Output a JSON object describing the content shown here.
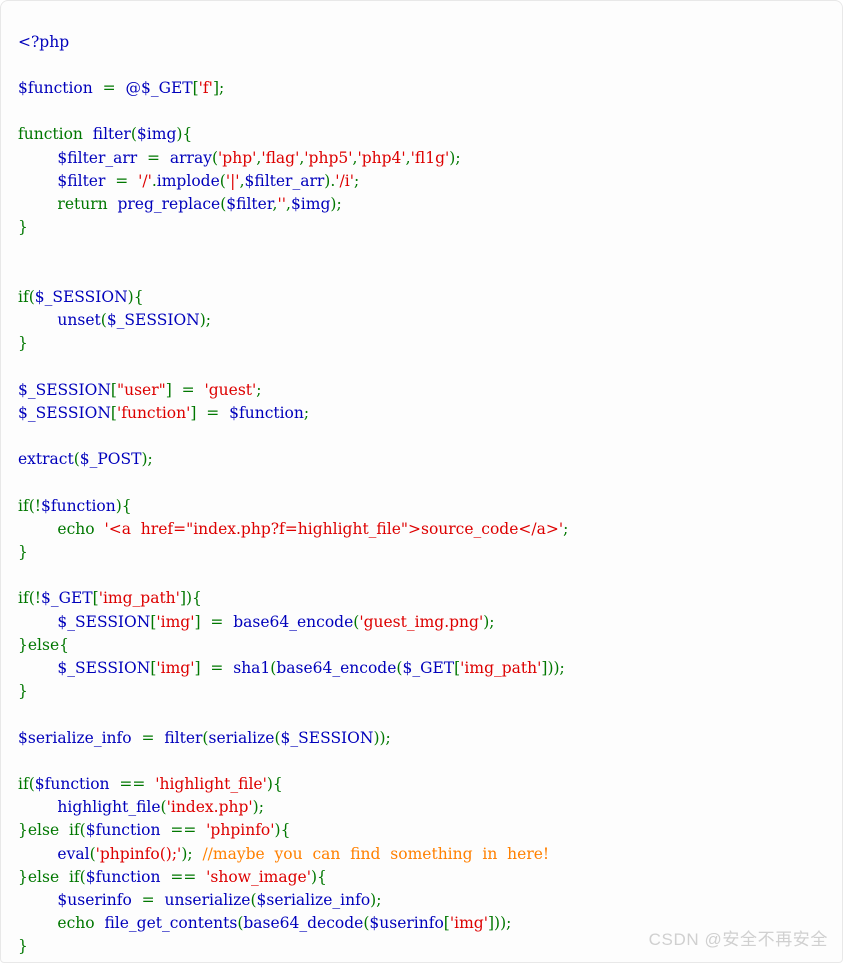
{
  "panel": {
    "background_color": "#fdfdfd",
    "border_color": "#e8e8e8"
  },
  "palette": {
    "keyword": "#007700",
    "string": "#dd0000",
    "default": "#0000bb",
    "comment": "#ff8000",
    "html": "#000000"
  },
  "watermark": {
    "text": "CSDN @安全不再安全",
    "color": "#d0d0d0"
  },
  "code": {
    "language": "php",
    "lines": [
      {
        "n": 1,
        "tokens": [
          {
            "t": "php",
            "v": "<?php"
          }
        ]
      },
      {
        "n": 2,
        "tokens": []
      },
      {
        "n": 3,
        "tokens": [
          {
            "t": "default",
            "v": "$function"
          },
          {
            "t": "keyword",
            "v": "  =  "
          },
          {
            "t": "default",
            "v": "@$_GET"
          },
          {
            "t": "keyword",
            "v": "["
          },
          {
            "t": "string",
            "v": "'f'"
          },
          {
            "t": "keyword",
            "v": "];"
          }
        ]
      },
      {
        "n": 4,
        "tokens": []
      },
      {
        "n": 5,
        "tokens": [
          {
            "t": "keyword",
            "v": "function "
          },
          {
            "t": "default",
            "v": " filter"
          },
          {
            "t": "keyword",
            "v": "("
          },
          {
            "t": "default",
            "v": "$img"
          },
          {
            "t": "keyword",
            "v": "){"
          }
        ]
      },
      {
        "n": 6,
        "tokens": [
          {
            "t": "keyword",
            "v": "        "
          },
          {
            "t": "default",
            "v": "$filter_arr"
          },
          {
            "t": "keyword",
            "v": "  =  "
          },
          {
            "t": "default",
            "v": "array"
          },
          {
            "t": "keyword",
            "v": "("
          },
          {
            "t": "string",
            "v": "'php'"
          },
          {
            "t": "keyword",
            "v": ","
          },
          {
            "t": "string",
            "v": "'flag'"
          },
          {
            "t": "keyword",
            "v": ","
          },
          {
            "t": "string",
            "v": "'php5'"
          },
          {
            "t": "keyword",
            "v": ","
          },
          {
            "t": "string",
            "v": "'php4'"
          },
          {
            "t": "keyword",
            "v": ","
          },
          {
            "t": "string",
            "v": "'fl1g'"
          },
          {
            "t": "keyword",
            "v": ");"
          }
        ]
      },
      {
        "n": 7,
        "tokens": [
          {
            "t": "keyword",
            "v": "        "
          },
          {
            "t": "default",
            "v": "$filter"
          },
          {
            "t": "keyword",
            "v": "  =  "
          },
          {
            "t": "string",
            "v": "'/'"
          },
          {
            "t": "keyword",
            "v": "."
          },
          {
            "t": "default",
            "v": "implode"
          },
          {
            "t": "keyword",
            "v": "("
          },
          {
            "t": "string",
            "v": "'|'"
          },
          {
            "t": "keyword",
            "v": ","
          },
          {
            "t": "default",
            "v": "$filter_arr"
          },
          {
            "t": "keyword",
            "v": ")."
          },
          {
            "t": "string",
            "v": "'/i'"
          },
          {
            "t": "keyword",
            "v": ";"
          }
        ]
      },
      {
        "n": 8,
        "tokens": [
          {
            "t": "keyword",
            "v": "        return "
          },
          {
            "t": "default",
            "v": " preg_replace"
          },
          {
            "t": "keyword",
            "v": "("
          },
          {
            "t": "default",
            "v": "$filter"
          },
          {
            "t": "keyword",
            "v": ","
          },
          {
            "t": "string",
            "v": "''"
          },
          {
            "t": "keyword",
            "v": ","
          },
          {
            "t": "default",
            "v": "$img"
          },
          {
            "t": "keyword",
            "v": ");"
          }
        ]
      },
      {
        "n": 9,
        "tokens": [
          {
            "t": "keyword",
            "v": "}"
          }
        ]
      },
      {
        "n": 10,
        "tokens": []
      },
      {
        "n": 11,
        "tokens": []
      },
      {
        "n": 12,
        "tokens": [
          {
            "t": "keyword",
            "v": "if"
          },
          {
            "t": "keyword",
            "v": "("
          },
          {
            "t": "default",
            "v": "$_SESSION"
          },
          {
            "t": "keyword",
            "v": "){"
          }
        ]
      },
      {
        "n": 13,
        "tokens": [
          {
            "t": "keyword",
            "v": "        "
          },
          {
            "t": "default",
            "v": "unset"
          },
          {
            "t": "keyword",
            "v": "("
          },
          {
            "t": "default",
            "v": "$_SESSION"
          },
          {
            "t": "keyword",
            "v": ");"
          }
        ]
      },
      {
        "n": 14,
        "tokens": [
          {
            "t": "keyword",
            "v": "}"
          }
        ]
      },
      {
        "n": 15,
        "tokens": []
      },
      {
        "n": 16,
        "tokens": [
          {
            "t": "default",
            "v": "$_SESSION"
          },
          {
            "t": "keyword",
            "v": "["
          },
          {
            "t": "string",
            "v": "\"user\""
          },
          {
            "t": "keyword",
            "v": "]  =  "
          },
          {
            "t": "string",
            "v": "'guest'"
          },
          {
            "t": "keyword",
            "v": ";"
          }
        ]
      },
      {
        "n": 17,
        "tokens": [
          {
            "t": "default",
            "v": "$_SESSION"
          },
          {
            "t": "keyword",
            "v": "["
          },
          {
            "t": "string",
            "v": "'function'"
          },
          {
            "t": "keyword",
            "v": "]  =  "
          },
          {
            "t": "default",
            "v": "$function"
          },
          {
            "t": "keyword",
            "v": ";"
          }
        ]
      },
      {
        "n": 18,
        "tokens": []
      },
      {
        "n": 19,
        "tokens": [
          {
            "t": "default",
            "v": "extract"
          },
          {
            "t": "keyword",
            "v": "("
          },
          {
            "t": "default",
            "v": "$_POST"
          },
          {
            "t": "keyword",
            "v": ");"
          }
        ]
      },
      {
        "n": 20,
        "tokens": []
      },
      {
        "n": 21,
        "tokens": [
          {
            "t": "keyword",
            "v": "if"
          },
          {
            "t": "keyword",
            "v": "(!"
          },
          {
            "t": "default",
            "v": "$function"
          },
          {
            "t": "keyword",
            "v": "){"
          }
        ]
      },
      {
        "n": 22,
        "tokens": [
          {
            "t": "keyword",
            "v": "        echo  "
          },
          {
            "t": "string",
            "v": "'<a  href=\"index.php?f=highlight_file\">source_code</a>'"
          },
          {
            "t": "keyword",
            "v": ";"
          }
        ]
      },
      {
        "n": 23,
        "tokens": [
          {
            "t": "keyword",
            "v": "}"
          }
        ]
      },
      {
        "n": 24,
        "tokens": []
      },
      {
        "n": 25,
        "tokens": [
          {
            "t": "keyword",
            "v": "if"
          },
          {
            "t": "keyword",
            "v": "(!"
          },
          {
            "t": "default",
            "v": "$_GET"
          },
          {
            "t": "keyword",
            "v": "["
          },
          {
            "t": "string",
            "v": "'img_path'"
          },
          {
            "t": "keyword",
            "v": "]){"
          }
        ]
      },
      {
        "n": 26,
        "tokens": [
          {
            "t": "keyword",
            "v": "        "
          },
          {
            "t": "default",
            "v": "$_SESSION"
          },
          {
            "t": "keyword",
            "v": "["
          },
          {
            "t": "string",
            "v": "'img'"
          },
          {
            "t": "keyword",
            "v": "]  =  "
          },
          {
            "t": "default",
            "v": "base64_encode"
          },
          {
            "t": "keyword",
            "v": "("
          },
          {
            "t": "string",
            "v": "'guest_img.png'"
          },
          {
            "t": "keyword",
            "v": ");"
          }
        ]
      },
      {
        "n": 27,
        "tokens": [
          {
            "t": "keyword",
            "v": "}else{"
          }
        ]
      },
      {
        "n": 28,
        "tokens": [
          {
            "t": "keyword",
            "v": "        "
          },
          {
            "t": "default",
            "v": "$_SESSION"
          },
          {
            "t": "keyword",
            "v": "["
          },
          {
            "t": "string",
            "v": "'img'"
          },
          {
            "t": "keyword",
            "v": "]  =  "
          },
          {
            "t": "default",
            "v": "sha1"
          },
          {
            "t": "keyword",
            "v": "("
          },
          {
            "t": "default",
            "v": "base64_encode"
          },
          {
            "t": "keyword",
            "v": "("
          },
          {
            "t": "default",
            "v": "$_GET"
          },
          {
            "t": "keyword",
            "v": "["
          },
          {
            "t": "string",
            "v": "'img_path'"
          },
          {
            "t": "keyword",
            "v": "]));"
          }
        ]
      },
      {
        "n": 29,
        "tokens": [
          {
            "t": "keyword",
            "v": "}"
          }
        ]
      },
      {
        "n": 30,
        "tokens": []
      },
      {
        "n": 31,
        "tokens": [
          {
            "t": "default",
            "v": "$serialize_info"
          },
          {
            "t": "keyword",
            "v": "  =  "
          },
          {
            "t": "default",
            "v": "filter"
          },
          {
            "t": "keyword",
            "v": "("
          },
          {
            "t": "default",
            "v": "serialize"
          },
          {
            "t": "keyword",
            "v": "("
          },
          {
            "t": "default",
            "v": "$_SESSION"
          },
          {
            "t": "keyword",
            "v": "));"
          }
        ]
      },
      {
        "n": 32,
        "tokens": []
      },
      {
        "n": 33,
        "tokens": [
          {
            "t": "keyword",
            "v": "if"
          },
          {
            "t": "keyword",
            "v": "("
          },
          {
            "t": "default",
            "v": "$function"
          },
          {
            "t": "keyword",
            "v": "  ==  "
          },
          {
            "t": "string",
            "v": "'highlight_file'"
          },
          {
            "t": "keyword",
            "v": "){"
          }
        ]
      },
      {
        "n": 34,
        "tokens": [
          {
            "t": "keyword",
            "v": "        "
          },
          {
            "t": "default",
            "v": "highlight_file"
          },
          {
            "t": "keyword",
            "v": "("
          },
          {
            "t": "string",
            "v": "'index.php'"
          },
          {
            "t": "keyword",
            "v": ");"
          }
        ]
      },
      {
        "n": 35,
        "tokens": [
          {
            "t": "keyword",
            "v": "}else  if"
          },
          {
            "t": "keyword",
            "v": "("
          },
          {
            "t": "default",
            "v": "$function"
          },
          {
            "t": "keyword",
            "v": "  ==  "
          },
          {
            "t": "string",
            "v": "'phpinfo'"
          },
          {
            "t": "keyword",
            "v": "){"
          }
        ]
      },
      {
        "n": 36,
        "tokens": [
          {
            "t": "keyword",
            "v": "        "
          },
          {
            "t": "default",
            "v": "eval"
          },
          {
            "t": "keyword",
            "v": "("
          },
          {
            "t": "string",
            "v": "'phpinfo();'"
          },
          {
            "t": "keyword",
            "v": ");  "
          },
          {
            "t": "comment",
            "v": "//maybe  you  can  find  something  in  here!"
          }
        ]
      },
      {
        "n": 37,
        "tokens": [
          {
            "t": "keyword",
            "v": "}else  if"
          },
          {
            "t": "keyword",
            "v": "("
          },
          {
            "t": "default",
            "v": "$function"
          },
          {
            "t": "keyword",
            "v": "  ==  "
          },
          {
            "t": "string",
            "v": "'show_image'"
          },
          {
            "t": "keyword",
            "v": "){"
          }
        ]
      },
      {
        "n": 38,
        "tokens": [
          {
            "t": "keyword",
            "v": "        "
          },
          {
            "t": "default",
            "v": "$userinfo"
          },
          {
            "t": "keyword",
            "v": "  =  "
          },
          {
            "t": "default",
            "v": "unserialize"
          },
          {
            "t": "keyword",
            "v": "("
          },
          {
            "t": "default",
            "v": "$serialize_info"
          },
          {
            "t": "keyword",
            "v": ");"
          }
        ]
      },
      {
        "n": 39,
        "tokens": [
          {
            "t": "keyword",
            "v": "        echo  "
          },
          {
            "t": "default",
            "v": "file_get_contents"
          },
          {
            "t": "keyword",
            "v": "("
          },
          {
            "t": "default",
            "v": "base64_decode"
          },
          {
            "t": "keyword",
            "v": "("
          },
          {
            "t": "default",
            "v": "$userinfo"
          },
          {
            "t": "keyword",
            "v": "["
          },
          {
            "t": "string",
            "v": "'img'"
          },
          {
            "t": "keyword",
            "v": "]));"
          }
        ]
      },
      {
        "n": 40,
        "tokens": [
          {
            "t": "keyword",
            "v": "}"
          }
        ]
      }
    ]
  }
}
